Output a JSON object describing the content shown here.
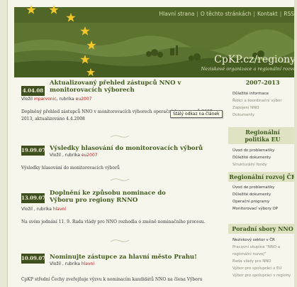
{
  "header": {
    "nav": [
      "Hlavní strana",
      "O těchto stránkách",
      "Kontakt",
      "RSS"
    ],
    "site_title": "CpKP.cz/regiony",
    "subtitle": "Neziskové organizace a regionální rozvo"
  },
  "articles": [
    {
      "date": "4.04.08",
      "title": "Aktualizovaný přehled zástupců NNO v monitorovacích výborech",
      "byline_prefix": "Vložil ",
      "author": "mparvonic",
      "byline_mid": ", rubrika ",
      "category": "eu2007",
      "body": "Doplněný přehled zástupců NNO v monitorovacích výborech operačních programů 2007–2013, aktualizováno 4.4.2008"
    },
    {
      "date": "19.09.07",
      "title": "Výsledky hlasování do monitorovacích výborů",
      "byline_prefix": "Vložil , rubrika ",
      "category": "eu2007",
      "body": "Výsledky hlasování do monitorovacích výborů"
    },
    {
      "date": "13.09.07",
      "title": "Doplnění ke způsobu nominace do Výboru pro regiony RNNO",
      "byline_prefix": "Vložil , rubrika ",
      "category": "hlavní",
      "body": "Na svém jednání 11. 9. Rada vlády pro NNO rozhodla o změně nominačního procesu."
    },
    {
      "date": "10.09.07",
      "title": "Nominujte zástupce za hlavní město Prahu!",
      "byline_prefix": "Vložil , rubrika ",
      "category": "hlavní",
      "body": "CpKP střední Čechy zveřejňuje výzvu k nominacím kandidátů NNO na člena Výboru"
    }
  ],
  "tooltip": "Stálý odkaz na článek",
  "sidebar": {
    "sections": [
      {
        "title": "2007-2013",
        "items": [
          {
            "label": "Důležité informace",
            "style": "dark"
          },
          {
            "label": "Řídící a koordinační výbor",
            "style": "muted"
          },
          {
            "label": "Zapojení NNO",
            "style": "muted"
          },
          {
            "label": "Dokumenty",
            "style": "muted"
          }
        ]
      },
      {
        "title": "Regionální politika EU",
        "items": [
          {
            "label": "Úvod do problematiky",
            "style": "dark"
          },
          {
            "label": "Důležité dokumenty",
            "style": "dark"
          },
          {
            "label": "Strukturální fondy",
            "style": "muted"
          }
        ]
      },
      {
        "title": "Regionální rozvoj ČR",
        "items": [
          {
            "label": "Úvod do problematiky",
            "style": "dark"
          },
          {
            "label": "Důležité dokumenty",
            "style": "dark"
          },
          {
            "label": "Operační programy",
            "style": "dark"
          },
          {
            "label": "Monitorovací výbory OP",
            "style": "dark"
          }
        ]
      },
      {
        "title": "Poradní sbory NNO",
        "items": [
          {
            "label": "Neziskový sektor v ČR",
            "style": "dark"
          },
          {
            "label": "Pracovní skupina \"NNO a",
            "style": "muted"
          },
          {
            "label": "regionální rozvoj\"",
            "style": "muted"
          },
          {
            "label": "Rada vlády pro NNO",
            "style": "muted"
          },
          {
            "label": "Výbor pro spolupráci s EU",
            "style": "muted"
          },
          {
            "label": "Výbor pro spolupráci s regiony",
            "style": "muted"
          }
        ]
      }
    ]
  },
  "colors": {
    "header_green": "#5c7430",
    "date_box": "#3f4f1f",
    "title_green": "#3f5a1c",
    "link_red": "#b01a1a",
    "star_gold": "#f3c62a"
  }
}
